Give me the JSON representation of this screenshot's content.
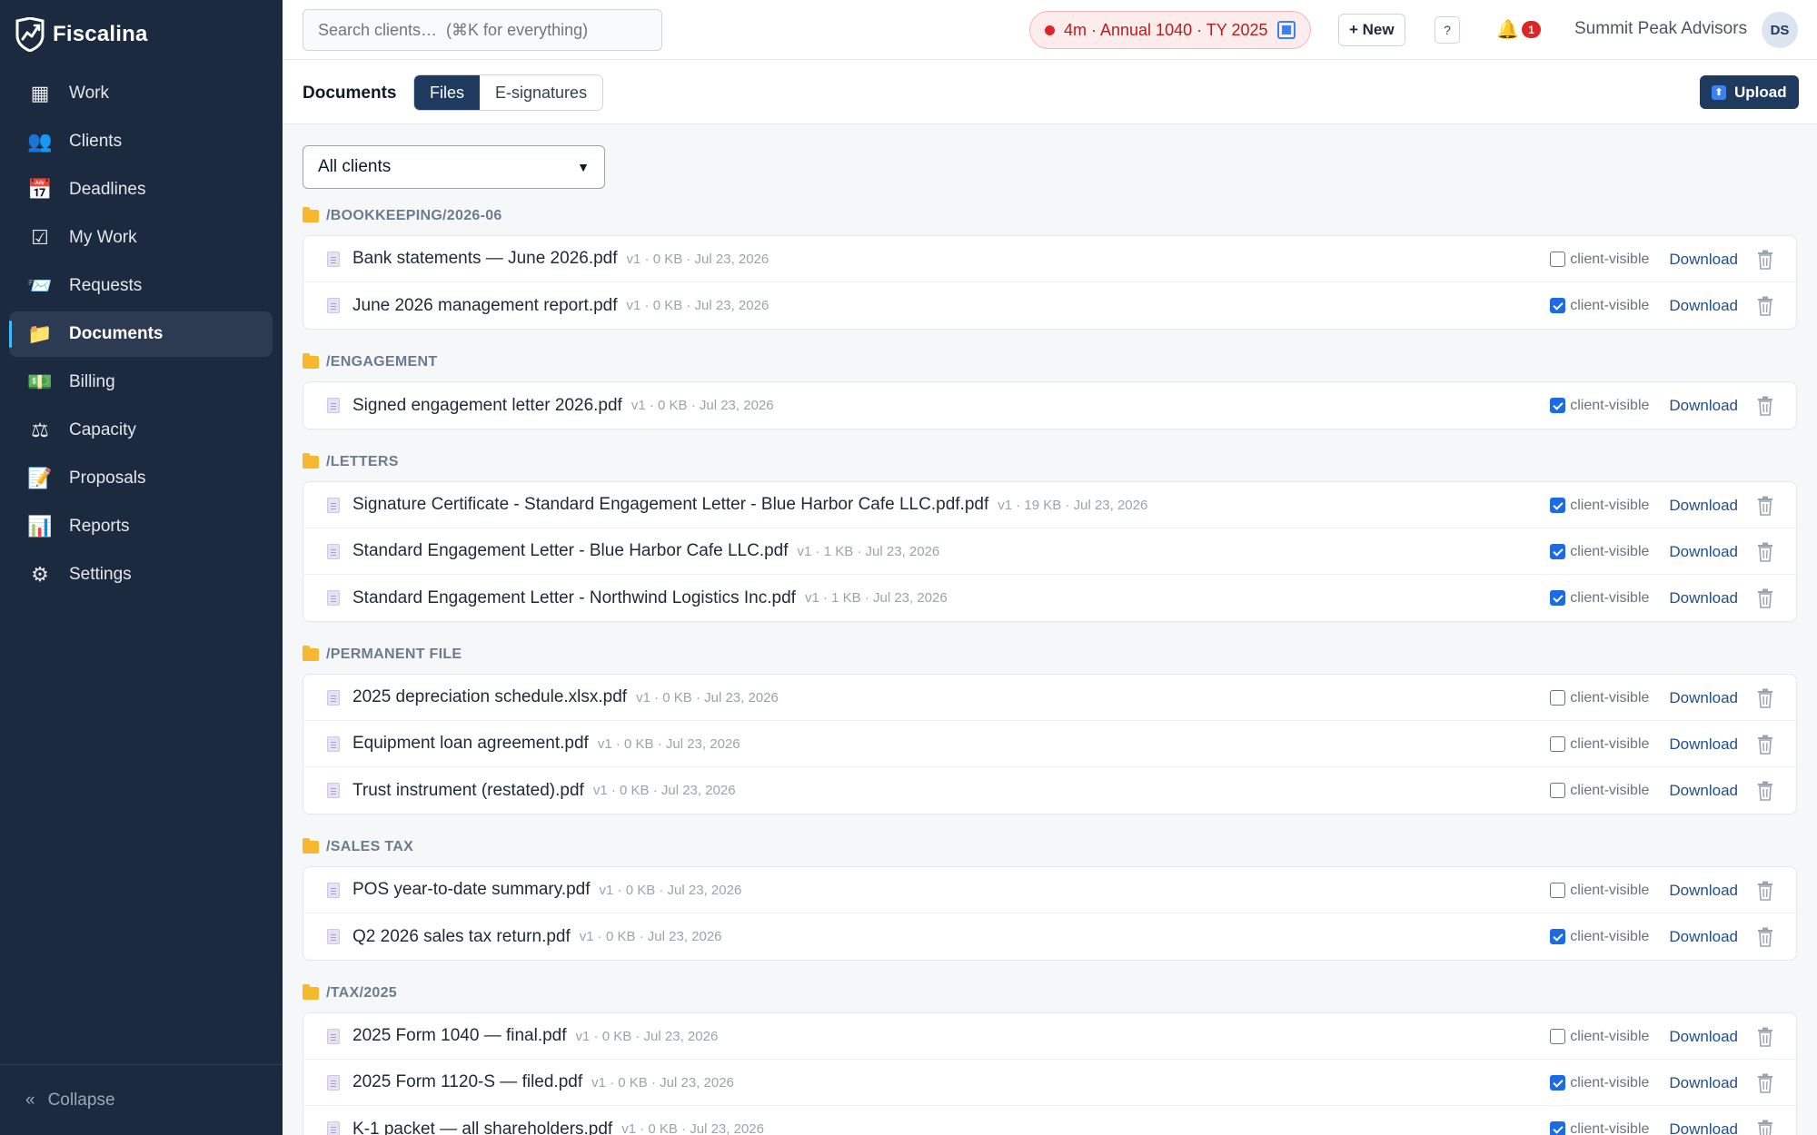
{
  "app": {
    "name": "Fiscalina"
  },
  "sidebar": {
    "items": [
      {
        "label": "Work",
        "icon": "grid-icon",
        "active": false
      },
      {
        "label": "Clients",
        "icon": "people-icon",
        "active": false
      },
      {
        "label": "Deadlines",
        "icon": "calendar-icon",
        "active": false
      },
      {
        "label": "My Work",
        "icon": "checkbox-icon",
        "active": false
      },
      {
        "label": "Requests",
        "icon": "tray-icon",
        "active": false
      },
      {
        "label": "Documents",
        "icon": "folder-icon",
        "active": true
      },
      {
        "label": "Billing",
        "icon": "money-icon",
        "active": false
      },
      {
        "label": "Capacity",
        "icon": "scales-icon",
        "active": false
      },
      {
        "label": "Proposals",
        "icon": "memo-icon",
        "active": false
      },
      {
        "label": "Reports",
        "icon": "bar-chart-icon",
        "active": false
      },
      {
        "label": "Settings",
        "icon": "gear-icon",
        "active": false
      }
    ],
    "collapse_label": "Collapse"
  },
  "topbar": {
    "search_placeholder": "Search clients…  (⌘K for everything)",
    "timer_label": "4m · Annual 1040 · TY 2025",
    "new_label": "+ New",
    "help_label": "?",
    "notification_count": "1",
    "org_name": "Summit Peak Advisors",
    "avatar_initials": "DS"
  },
  "subheader": {
    "title": "Documents",
    "tabs": [
      "Files",
      "E-signatures"
    ],
    "upload_label": "Upload"
  },
  "filter": {
    "selected": "All clients"
  },
  "labels": {
    "client_visible": "client-visible",
    "download": "Download"
  },
  "colors": {
    "sidebar_bg": "#1b2a3f",
    "accent": "#1e3a5f",
    "timer_red": "#dc2626",
    "link": "#1e4f8f"
  },
  "folders": [
    {
      "name": "/BOOKKEEPING/2026-06",
      "files": [
        {
          "name": "Bank statements — June 2026.pdf",
          "meta": "v1 · 0 KB · Jul 23, 2026",
          "client_visible": false
        },
        {
          "name": "June 2026 management report.pdf",
          "meta": "v1 · 0 KB · Jul 23, 2026",
          "client_visible": true
        }
      ]
    },
    {
      "name": "/ENGAGEMENT",
      "files": [
        {
          "name": "Signed engagement letter 2026.pdf",
          "meta": "v1 · 0 KB · Jul 23, 2026",
          "client_visible": true
        }
      ]
    },
    {
      "name": "/LETTERS",
      "files": [
        {
          "name": "Signature Certificate - Standard Engagement Letter - Blue Harbor Cafe LLC.pdf.pdf",
          "meta": "v1 · 19 KB · Jul 23, 2026",
          "client_visible": true
        },
        {
          "name": "Standard Engagement Letter - Blue Harbor Cafe LLC.pdf",
          "meta": "v1 · 1 KB · Jul 23, 2026",
          "client_visible": true
        },
        {
          "name": "Standard Engagement Letter - Northwind Logistics Inc.pdf",
          "meta": "v1 · 1 KB · Jul 23, 2026",
          "client_visible": true
        }
      ]
    },
    {
      "name": "/PERMANENT FILE",
      "files": [
        {
          "name": "2025 depreciation schedule.xlsx.pdf",
          "meta": "v1 · 0 KB · Jul 23, 2026",
          "client_visible": false
        },
        {
          "name": "Equipment loan agreement.pdf",
          "meta": "v1 · 0 KB · Jul 23, 2026",
          "client_visible": false
        },
        {
          "name": "Trust instrument (restated).pdf",
          "meta": "v1 · 0 KB · Jul 23, 2026",
          "client_visible": false
        }
      ]
    },
    {
      "name": "/SALES TAX",
      "files": [
        {
          "name": "POS year-to-date summary.pdf",
          "meta": "v1 · 0 KB · Jul 23, 2026",
          "client_visible": false
        },
        {
          "name": "Q2 2026 sales tax return.pdf",
          "meta": "v1 · 0 KB · Jul 23, 2026",
          "client_visible": true
        }
      ]
    },
    {
      "name": "/TAX/2025",
      "files": [
        {
          "name": "2025 Form 1040 — final.pdf",
          "meta": "v1 · 0 KB · Jul 23, 2026",
          "client_visible": false
        },
        {
          "name": "2025 Form 1120-S — filed.pdf",
          "meta": "v1 · 0 KB · Jul 23, 2026",
          "client_visible": true
        },
        {
          "name": "K-1 packet — all shareholders.pdf",
          "meta": "v1 · 0 KB · Jul 23, 2026",
          "client_visible": true
        }
      ]
    }
  ]
}
